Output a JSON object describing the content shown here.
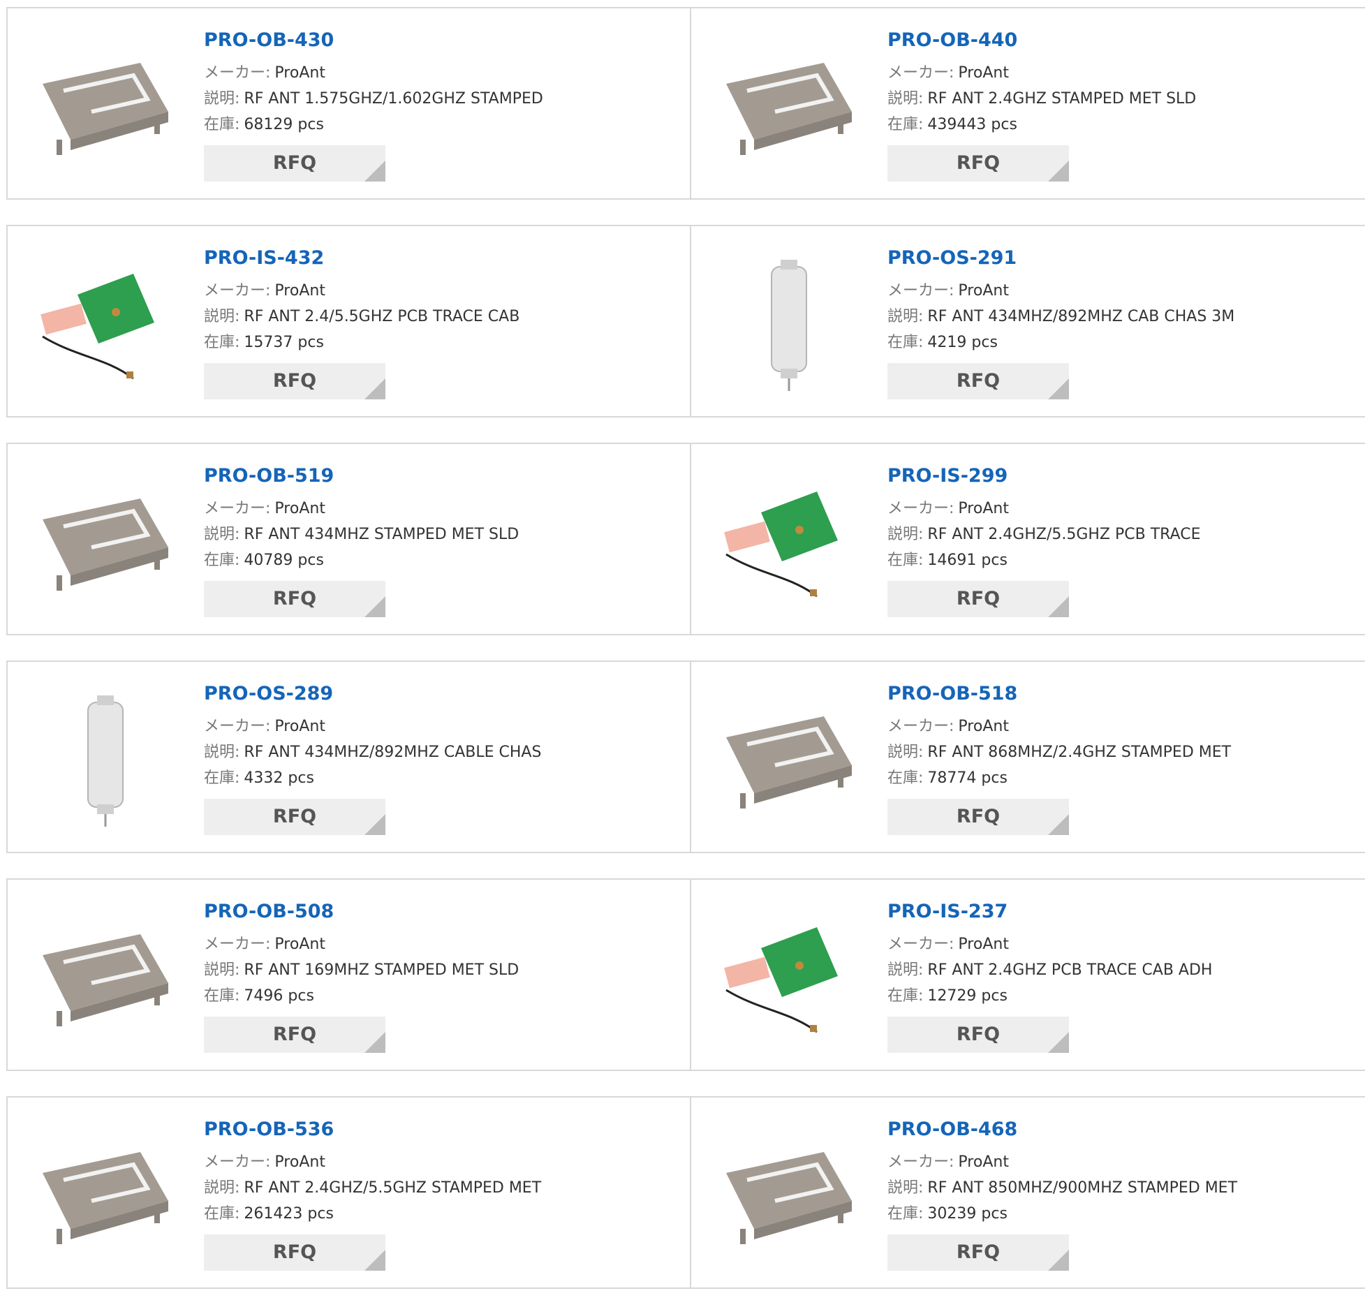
{
  "labels": {
    "maker": "メーカー:",
    "description": "説明:",
    "stock": "在庫:",
    "rfq": "RFQ"
  },
  "products": [
    {
      "part": "PRO-OB-430",
      "maker": "ProAnt",
      "desc": "RF ANT 1.575GHZ/1.602GHZ STAMPED",
      "stock": "68129 pcs",
      "image": "stamped-metal-antenna-image"
    },
    {
      "part": "PRO-OB-440",
      "maker": "ProAnt",
      "desc": "RF ANT 2.4GHZ STAMPED MET SLD",
      "stock": "439443 pcs",
      "image": "stamped-metal-antenna-image"
    },
    {
      "part": "PRO-IS-432",
      "maker": "ProAnt",
      "desc": "RF ANT 2.4/5.5GHZ PCB TRACE CAB",
      "stock": "15737 pcs",
      "image": "pcb-antenna-image"
    },
    {
      "part": "PRO-OS-291",
      "maker": "ProAnt",
      "desc": "RF ANT 434MHZ/892MHZ CAB CHAS 3M",
      "stock": "4219 pcs",
      "image": "chassis-antenna-image"
    },
    {
      "part": "PRO-OB-519",
      "maker": "ProAnt",
      "desc": "RF ANT 434MHZ STAMPED MET SLD",
      "stock": "40789 pcs",
      "image": "stamped-metal-antenna-image"
    },
    {
      "part": "PRO-IS-299",
      "maker": "ProAnt",
      "desc": "RF ANT 2.4GHZ/5.5GHZ PCB TRACE",
      "stock": "14691 pcs",
      "image": "pcb-antenna-image"
    },
    {
      "part": "PRO-OS-289",
      "maker": "ProAnt",
      "desc": "RF ANT 434MHZ/892MHZ CABLE CHAS",
      "stock": "4332 pcs",
      "image": "chassis-antenna-image"
    },
    {
      "part": "PRO-OB-518",
      "maker": "ProAnt",
      "desc": "RF ANT 868MHZ/2.4GHZ STAMPED MET",
      "stock": "78774 pcs",
      "image": "stamped-metal-antenna-image"
    },
    {
      "part": "PRO-OB-508",
      "maker": "ProAnt",
      "desc": "RF ANT 169MHZ STAMPED MET SLD",
      "stock": "7496 pcs",
      "image": "stamped-metal-antenna-image"
    },
    {
      "part": "PRO-IS-237",
      "maker": "ProAnt",
      "desc": "RF ANT 2.4GHZ PCB TRACE CAB ADH",
      "stock": "12729 pcs",
      "image": "pcb-antenna-image"
    },
    {
      "part": "PRO-OB-536",
      "maker": "ProAnt",
      "desc": "RF ANT 2.4GHZ/5.5GHZ STAMPED MET",
      "stock": "261423 pcs",
      "image": "stamped-metal-antenna-image"
    },
    {
      "part": "PRO-OB-468",
      "maker": "ProAnt",
      "desc": "RF ANT 850MHZ/900MHZ STAMPED MET",
      "stock": "30239 pcs",
      "image": "stamped-metal-antenna-image"
    }
  ],
  "colors": {
    "link": "#1565b8",
    "border": "#d8d8d8",
    "button_bg": "#eeeeee",
    "button_corner": "#bdbdbd",
    "label": "#777777"
  }
}
